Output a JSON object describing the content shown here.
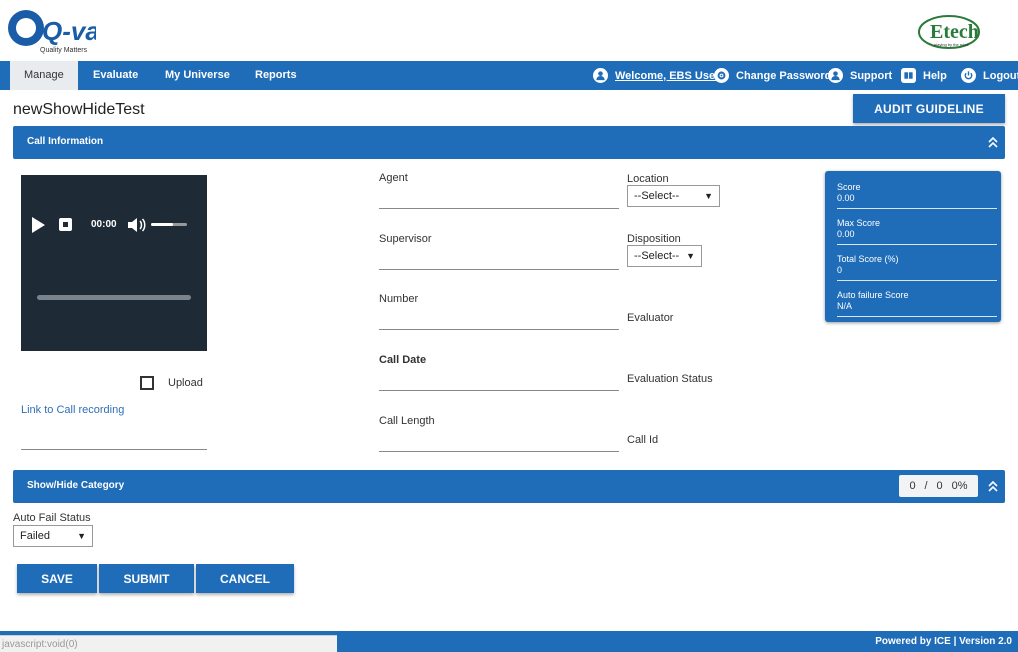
{
  "header": {
    "logo_text": "Q-val",
    "logo_tagline": "Quality Matters",
    "partner_logo_text": "Etech",
    "partner_tagline": "playing by the rules"
  },
  "nav": {
    "tabs": [
      {
        "label": "Manage",
        "active": true
      },
      {
        "label": "Evaluate"
      },
      {
        "label": "My Universe"
      },
      {
        "label": "Reports"
      }
    ],
    "welcome": "Welcome, EBS User",
    "change_password": "Change Password",
    "support": "Support",
    "help": "Help",
    "logout": "Logout"
  },
  "page": {
    "title": "newShowHideTest",
    "audit_button": "AUDIT GUIDELINE"
  },
  "call_info": {
    "section_label": "Call Information",
    "player": {
      "time": "00:00",
      "volume_fraction": 0.6,
      "progress_fraction": 0
    },
    "upload_label": "Upload",
    "link_recording": "Link to Call recording",
    "fields": {
      "agent": "Agent",
      "supervisor": "Supervisor",
      "number": "Number",
      "call_date": "Call Date",
      "call_length": "Call Length",
      "location": "Location",
      "location_value": "--Select--",
      "disposition": "Disposition",
      "disposition_value": "--Select--",
      "evaluator": "Evaluator",
      "evaluation_status": "Evaluation Status",
      "call_id": "Call Id"
    },
    "scores": [
      {
        "label": "Score",
        "value": "0.00"
      },
      {
        "label": "Max Score",
        "value": "0.00"
      },
      {
        "label": "Total Score (%)",
        "value": "0"
      },
      {
        "label": "Auto failure Score",
        "value": "N/A"
      }
    ]
  },
  "category": {
    "section_label": "Show/Hide Category",
    "counter": {
      "a": "0",
      "sep": "/",
      "b": "0",
      "pct": "0%"
    }
  },
  "auto_fail": {
    "label": "Auto Fail Status",
    "value": "Failed"
  },
  "actions": {
    "save": "SAVE",
    "submit": "SUBMIT",
    "cancel": "CANCEL"
  },
  "footer": {
    "status_url": "javascript:void(0)",
    "powered_by": "Powered by ICE | Version 2.0"
  },
  "colors": {
    "primary": "#1f6cb8",
    "player_bg": "#1e2a36",
    "logo_blue": "#1a5ca8",
    "etech_green": "#2a7a3a"
  }
}
